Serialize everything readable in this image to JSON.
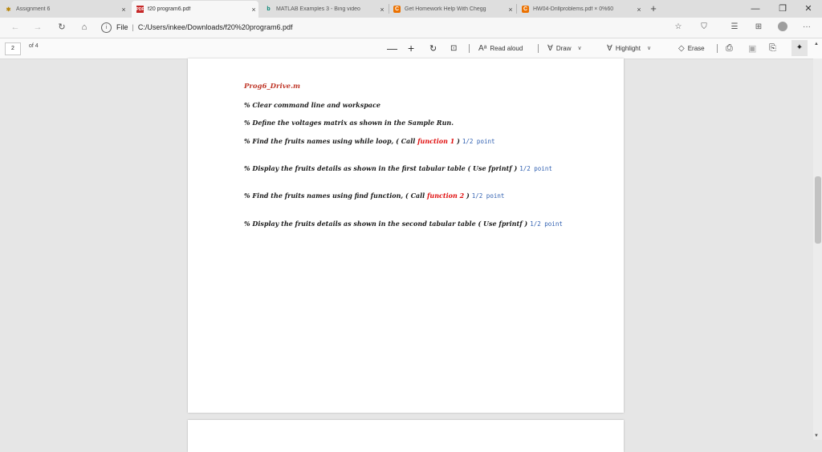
{
  "tabs": [
    {
      "title": "Assignment 6",
      "icon": "asu-icon",
      "active": false
    },
    {
      "title": "f20 program6.pdf",
      "icon": "pdf-icon",
      "active": true
    },
    {
      "title": "MATLAB Examples 3 - Bing video",
      "icon": "bing-icon",
      "active": false
    },
    {
      "title": "Get Homework Help With Chegg",
      "icon": "chegg-icon",
      "active": false
    },
    {
      "title": "HW04-Drillproblems.pdf × 0%60",
      "icon": "chegg-icon",
      "active": false
    }
  ],
  "address": {
    "scheme_label": "File",
    "url": "C:/Users/inkee/Downloads/f20%20program6.pdf"
  },
  "pdf_toolbar": {
    "page_number": "2",
    "page_total": "of 4",
    "read_aloud": "Read aloud",
    "draw": "Draw",
    "highlight": "Highlight",
    "erase": "Erase"
  },
  "document": {
    "title": "Prog6_Drive.m",
    "lines": [
      {
        "text": "% Clear command line and workspace",
        "pre": "",
        "red": "",
        "post": "",
        "points": ""
      },
      {
        "text": "% Define the voltages matrix as shown in the Sample Run.",
        "pre": "",
        "red": "",
        "post": "",
        "points": ""
      },
      {
        "text": "% Find the fruits names using while loop, ( Call ",
        "red": "function 1",
        "post": " )",
        "points": "1/2 point"
      },
      {
        "text": "% Display the fruits details as shown in the first tabular table ( Use fprintf )",
        "red": "",
        "post": "",
        "points": "1/2 point"
      },
      {
        "text": "% Find the fruits names using find function, ( Call ",
        "red": "function 2",
        "post": " )",
        "points": "1/2 point"
      },
      {
        "text": "% Display the fruits details as shown in the second tabular table ( Use fprintf )",
        "red": "",
        "post": "",
        "points": "1/2 point"
      }
    ]
  }
}
